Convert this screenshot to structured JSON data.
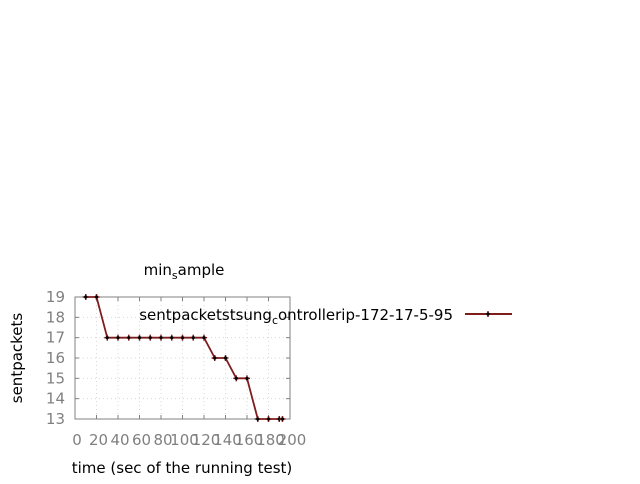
{
  "chart_data": {
    "type": "line",
    "title_main": "min",
    "title_sub": "s",
    "title_rest": "ample",
    "xlabel": "time (sec of the running test)",
    "ylabel": "sentpackets",
    "xlim": [
      0,
      200
    ],
    "ylim": [
      13,
      19
    ],
    "x_ticks": [
      0,
      20,
      40,
      60,
      80,
      100,
      120,
      140,
      160,
      180,
      200
    ],
    "y_ticks": [
      13,
      14,
      15,
      16,
      17,
      18,
      19
    ],
    "grid": true,
    "legend_position": "right",
    "colors": {
      "series": "#7f1d1d",
      "tick_text": "#808080",
      "grid": "#d8d8d8",
      "axis": "#808080"
    },
    "series": [
      {
        "legend_pre": "sentpacketstsung",
        "legend_sub": "c",
        "legend_post": "ontrollerip-172-17-5-95",
        "x": [
          10,
          20,
          30,
          40,
          50,
          60,
          70,
          80,
          90,
          100,
          110,
          120,
          130,
          140,
          150,
          160,
          170,
          180,
          190,
          193
        ],
        "y": [
          19,
          19,
          17,
          17,
          17,
          17,
          17,
          17,
          17,
          17,
          17,
          17,
          16,
          16,
          15,
          15,
          13,
          13,
          13,
          13
        ]
      }
    ]
  }
}
